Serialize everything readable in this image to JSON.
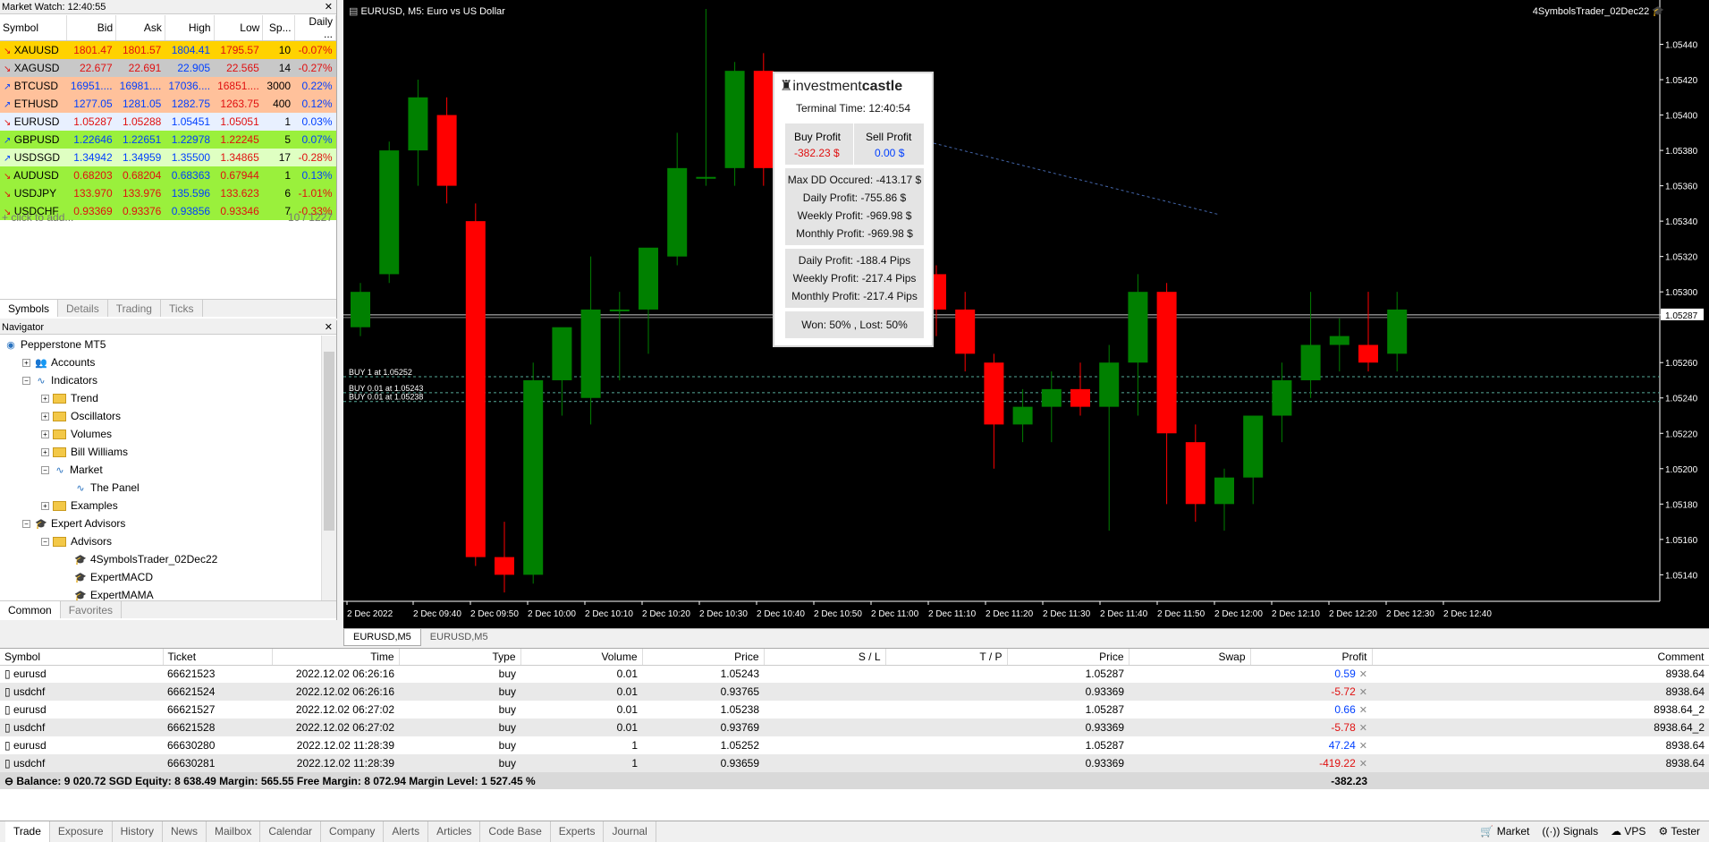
{
  "market_watch": {
    "title": "Market Watch: 12:40:55",
    "columns": [
      "Symbol",
      "Bid",
      "Ask",
      "High",
      "Low",
      "Sp...",
      "Daily ..."
    ],
    "rows": [
      {
        "symbol": "XAUUSD",
        "bid": "1801.47",
        "ask": "1801.57",
        "high": "1804.41",
        "low": "1795.57",
        "spread": "10",
        "daily": "-0.07%",
        "bg": "#ffd200",
        "dir": "down"
      },
      {
        "symbol": "XAGUSD",
        "bid": "22.677",
        "ask": "22.691",
        "high": "22.905",
        "low": "22.565",
        "spread": "14",
        "daily": "-0.27%",
        "bg": "#c8c8c8",
        "dir": "down"
      },
      {
        "symbol": "BTCUSD",
        "bid": "16951....",
        "ask": "16981....",
        "high": "17036....",
        "low": "16851....",
        "spread": "3000",
        "daily": "0.22%",
        "bg": "#ffc19b",
        "dir": "up"
      },
      {
        "symbol": "ETHUSD",
        "bid": "1277.05",
        "ask": "1281.05",
        "high": "1282.75",
        "low": "1263.75",
        "spread": "400",
        "daily": "0.12%",
        "bg": "#ffc19b",
        "dir": "up"
      },
      {
        "symbol": "EURUSD",
        "bid": "1.05287",
        "ask": "1.05288",
        "high": "1.05451",
        "low": "1.05051",
        "spread": "1",
        "daily": "0.03%",
        "bg": "#e8f0ff",
        "dir": "down"
      },
      {
        "symbol": "GBPUSD",
        "bid": "1.22646",
        "ask": "1.22651",
        "high": "1.22978",
        "low": "1.22245",
        "spread": "5",
        "daily": "0.07%",
        "bg": "#9af03c",
        "dir": "up"
      },
      {
        "symbol": "USDSGD",
        "bid": "1.34942",
        "ask": "1.34959",
        "high": "1.35500",
        "low": "1.34865",
        "spread": "17",
        "daily": "-0.28%",
        "bg": "#dfffc2",
        "dir": "up"
      },
      {
        "symbol": "AUDUSD",
        "bid": "0.68203",
        "ask": "0.68204",
        "high": "0.68363",
        "low": "0.67944",
        "spread": "1",
        "daily": "0.13%",
        "bg": "#9af03c",
        "dir": "down"
      },
      {
        "symbol": "USDJPY",
        "bid": "133.970",
        "ask": "133.976",
        "high": "135.596",
        "low": "133.623",
        "spread": "6",
        "daily": "-1.01%",
        "bg": "#9af03c",
        "dir": "down"
      },
      {
        "symbol": "USDCHF",
        "bid": "0.93369",
        "ask": "0.93376",
        "high": "0.93856",
        "low": "0.93346",
        "spread": "7",
        "daily": "-0.33%",
        "bg": "#9af03c",
        "dir": "down"
      }
    ],
    "add_label": "click to add...",
    "count": "10 / 1227",
    "tabs": [
      "Symbols",
      "Details",
      "Trading",
      "Ticks"
    ]
  },
  "navigator": {
    "title": "Navigator",
    "items": [
      {
        "label": "Pepperstone MT5",
        "level": 0,
        "icon": "globe-icon",
        "exp": ""
      },
      {
        "label": "Accounts",
        "level": 1,
        "icon": "accounts-icon",
        "exp": "+"
      },
      {
        "label": "Indicators",
        "level": 1,
        "icon": "indicator-icon",
        "exp": "-"
      },
      {
        "label": "Trend",
        "level": 2,
        "icon": "folder-icon",
        "exp": "+"
      },
      {
        "label": "Oscillators",
        "level": 2,
        "icon": "folder-icon",
        "exp": "+"
      },
      {
        "label": "Volumes",
        "level": 2,
        "icon": "folder-icon",
        "exp": "+"
      },
      {
        "label": "Bill Williams",
        "level": 2,
        "icon": "folder-icon",
        "exp": "+"
      },
      {
        "label": "Market",
        "level": 2,
        "icon": "indicator-icon",
        "exp": "-"
      },
      {
        "label": "The Panel",
        "level": 3,
        "icon": "indicator-icon",
        "exp": ""
      },
      {
        "label": "Examples",
        "level": 2,
        "icon": "folder-icon",
        "exp": "+"
      },
      {
        "label": "Expert Advisors",
        "level": 1,
        "icon": "expert-icon",
        "exp": "-"
      },
      {
        "label": "Advisors",
        "level": 2,
        "icon": "folder-icon",
        "exp": "-"
      },
      {
        "label": "4SymbolsTrader_02Dec22",
        "level": 3,
        "icon": "expert-icon",
        "exp": ""
      },
      {
        "label": "ExpertMACD",
        "level": 3,
        "icon": "expert-icon",
        "exp": ""
      },
      {
        "label": "ExpertMAMA",
        "level": 3,
        "icon": "expert-icon",
        "exp": ""
      },
      {
        "label": "ExpertMAPSAR",
        "level": 3,
        "icon": "expert-icon",
        "exp": ""
      }
    ],
    "tabs": [
      "Common",
      "Favorites"
    ]
  },
  "chart": {
    "title": "EURUSD, M5:  Euro vs US Dollar",
    "ea_name": "4SymbolsTrader_02Dec22",
    "price_labels": [
      "1.05440",
      "1.05420",
      "1.05400",
      "1.05380",
      "1.05360",
      "1.05340",
      "1.05320",
      "1.05300",
      "1.05287",
      "1.05260",
      "1.05240",
      "1.05220",
      "1.05200",
      "1.05180",
      "1.05160",
      "1.05140"
    ],
    "time_labels": [
      "2 Dec 2022",
      "2 Dec 09:40",
      "2 Dec 09:50",
      "2 Dec 10:00",
      "2 Dec 10:10",
      "2 Dec 10:20",
      "2 Dec 10:30",
      "2 Dec 10:40",
      "2 Dec 10:50",
      "2 Dec 11:00",
      "2 Dec 11:10",
      "2 Dec 11:20",
      "2 Dec 11:30",
      "2 Dec 11:40",
      "2 Dec 11:50",
      "2 Dec 12:00",
      "2 Dec 12:10",
      "2 Dec 12:20",
      "2 Dec 12:30",
      "2 Dec 12:40"
    ],
    "order_lines": [
      "BUY 1 at 1.05252",
      "BUY 0.01 at 1.05243",
      "BUY 0.01 at 1.05238"
    ],
    "tabs": [
      "EURUSD,M5",
      "EURUSD,M5"
    ]
  },
  "panel": {
    "brand_a": "investment",
    "brand_b": "castle",
    "terminal_time": "Terminal Time: 12:40:54",
    "buy_label": "Buy Profit",
    "sell_label": "Sell Profit",
    "buy_value": "-382.23 $",
    "sell_value": "0.00 $",
    "stats": [
      "Max DD Occured: -413.17 $",
      "Daily Profit: -755.86 $",
      "Weekly Profit: -969.98 $",
      "Monthly Profit: -969.98 $"
    ],
    "pips": [
      "Daily Profit: -188.4 Pips",
      "Weekly Profit: -217.4 Pips",
      "Monthly Profit: -217.4 Pips"
    ],
    "winloss": "Won: 50% , Lost: 50%"
  },
  "trade": {
    "columns": [
      "Symbol",
      "Ticket",
      "Time",
      "Type",
      "Volume",
      "Price",
      "S / L",
      "T / P",
      "Price",
      "Swap",
      "Profit",
      "Comment"
    ],
    "rows": [
      [
        "eurusd",
        "66621523",
        "2022.12.02 06:26:16",
        "buy",
        "0.01",
        "1.05243",
        "",
        "",
        "1.05287",
        "",
        "0.59",
        "8938.64"
      ],
      [
        "usdchf",
        "66621524",
        "2022.12.02 06:26:16",
        "buy",
        "0.01",
        "0.93765",
        "",
        "",
        "0.93369",
        "",
        "-5.72",
        "8938.64"
      ],
      [
        "eurusd",
        "66621527",
        "2022.12.02 06:27:02",
        "buy",
        "0.01",
        "1.05238",
        "",
        "",
        "1.05287",
        "",
        "0.66",
        "8938.64_2"
      ],
      [
        "usdchf",
        "66621528",
        "2022.12.02 06:27:02",
        "buy",
        "0.01",
        "0.93769",
        "",
        "",
        "0.93369",
        "",
        "-5.78",
        "8938.64_2"
      ],
      [
        "eurusd",
        "66630280",
        "2022.12.02 11:28:39",
        "buy",
        "1",
        "1.05252",
        "",
        "",
        "1.05287",
        "",
        "47.24",
        "8938.64"
      ],
      [
        "usdchf",
        "66630281",
        "2022.12.02 11:28:39",
        "buy",
        "1",
        "0.93659",
        "",
        "",
        "0.93369",
        "",
        "-419.22",
        "8938.64"
      ]
    ],
    "balance_line": "Balance: 9 020.72 SGD  Equity: 8 638.49  Margin: 565.55  Free Margin: 8 072.94  Margin Level: 1 527.45 %",
    "total_profit": "-382.23"
  },
  "bottom_tabs": [
    "Trade",
    "Exposure",
    "History",
    "News",
    "Mailbox",
    "Calendar",
    "Company",
    "Alerts",
    "Articles",
    "Code Base",
    "Experts",
    "Journal"
  ],
  "bottom_right": [
    "Market",
    "Signals",
    "VPS",
    "Tester"
  ],
  "colors": {
    "bull": "#008000",
    "bear": "#ff0000",
    "bg": "#000000"
  }
}
